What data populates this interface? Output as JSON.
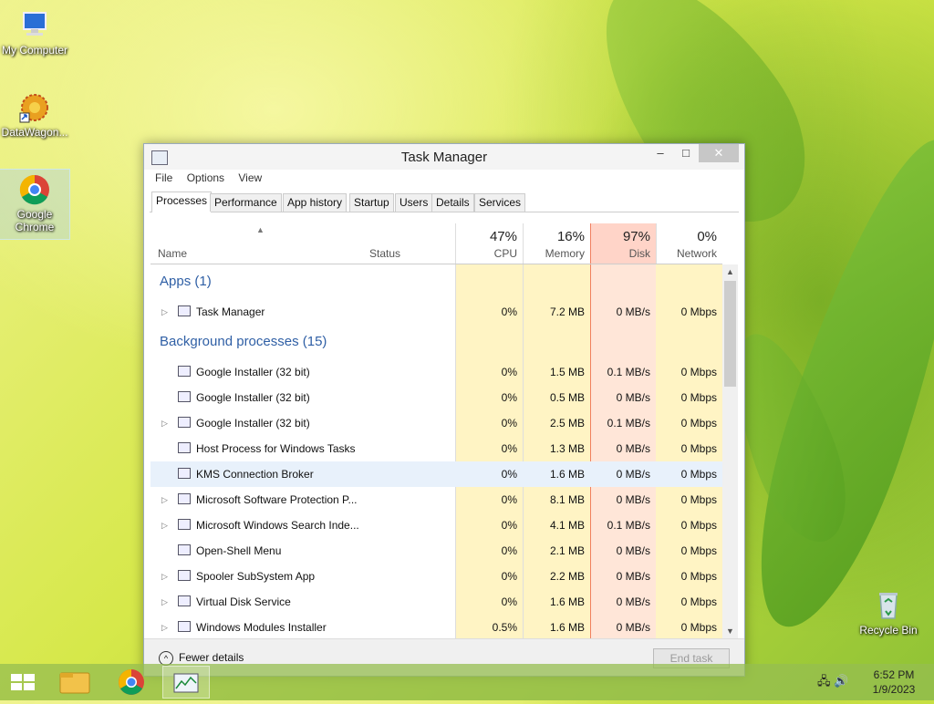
{
  "desktop": {
    "icons": [
      {
        "label": "My Computer"
      },
      {
        "label": "DataWagon..."
      },
      {
        "label": "Google Chrome"
      },
      {
        "label": "Recycle Bin"
      }
    ]
  },
  "window": {
    "title": "Task Manager",
    "controls": {
      "minimize": "–",
      "maximize": "□",
      "close": "✕"
    },
    "menu": [
      "File",
      "Options",
      "View"
    ],
    "tabs": [
      "Processes",
      "Performance",
      "App history",
      "Startup",
      "Users",
      "Details",
      "Services"
    ],
    "active_tab": "Processes",
    "columns": {
      "name": "Name",
      "status": "Status",
      "cpu": {
        "pct": "47%",
        "label": "CPU"
      },
      "memory": {
        "pct": "16%",
        "label": "Memory"
      },
      "disk": {
        "pct": "97%",
        "label": "Disk"
      },
      "network": {
        "pct": "0%",
        "label": "Network"
      }
    },
    "groups": {
      "apps": "Apps (1)",
      "background": "Background processes (15)"
    },
    "apps": [
      {
        "name": "Task Manager",
        "cpu": "0%",
        "memory": "7.2 MB",
        "disk": "0 MB/s",
        "network": "0 Mbps",
        "expandable": true
      }
    ],
    "background": [
      {
        "name": "Google Installer (32 bit)",
        "cpu": "0%",
        "memory": "1.5 MB",
        "disk": "0.1 MB/s",
        "network": "0 Mbps",
        "expandable": false
      },
      {
        "name": "Google Installer (32 bit)",
        "cpu": "0%",
        "memory": "0.5 MB",
        "disk": "0 MB/s",
        "network": "0 Mbps",
        "expandable": false
      },
      {
        "name": "Google Installer (32 bit)",
        "cpu": "0%",
        "memory": "2.5 MB",
        "disk": "0.1 MB/s",
        "network": "0 Mbps",
        "expandable": true
      },
      {
        "name": "Host Process for Windows Tasks",
        "cpu": "0%",
        "memory": "1.3 MB",
        "disk": "0 MB/s",
        "network": "0 Mbps",
        "expandable": false
      },
      {
        "name": "KMS Connection Broker",
        "cpu": "0%",
        "memory": "1.6 MB",
        "disk": "0 MB/s",
        "network": "0 Mbps",
        "expandable": false,
        "selected": true
      },
      {
        "name": "Microsoft Software Protection P...",
        "cpu": "0%",
        "memory": "8.1 MB",
        "disk": "0 MB/s",
        "network": "0 Mbps",
        "expandable": true
      },
      {
        "name": "Microsoft Windows Search Inde...",
        "cpu": "0%",
        "memory": "4.1 MB",
        "disk": "0.1 MB/s",
        "network": "0 Mbps",
        "expandable": true
      },
      {
        "name": "Open-Shell Menu",
        "cpu": "0%",
        "memory": "2.1 MB",
        "disk": "0 MB/s",
        "network": "0 Mbps",
        "expandable": false
      },
      {
        "name": "Spooler SubSystem App",
        "cpu": "0%",
        "memory": "2.2 MB",
        "disk": "0 MB/s",
        "network": "0 Mbps",
        "expandable": true
      },
      {
        "name": "Virtual Disk Service",
        "cpu": "0%",
        "memory": "1.6 MB",
        "disk": "0 MB/s",
        "network": "0 Mbps",
        "expandable": true
      },
      {
        "name": "Windows Modules Installer",
        "cpu": "0.5%",
        "memory": "1.6 MB",
        "disk": "0 MB/s",
        "network": "0 Mbps",
        "expandable": true
      }
    ],
    "footer": {
      "fewer_details": "Fewer details",
      "end_task": "End task"
    }
  },
  "taskbar": {
    "time": "6:52 PM",
    "date": "1/9/2023"
  },
  "colors": {
    "disk_header": "#ffd4c8",
    "disk_col": "#ffe6d8",
    "heat_col": "#fff4c4",
    "group_text": "#2f5fa5",
    "selected_row": "#e8f1fb"
  }
}
